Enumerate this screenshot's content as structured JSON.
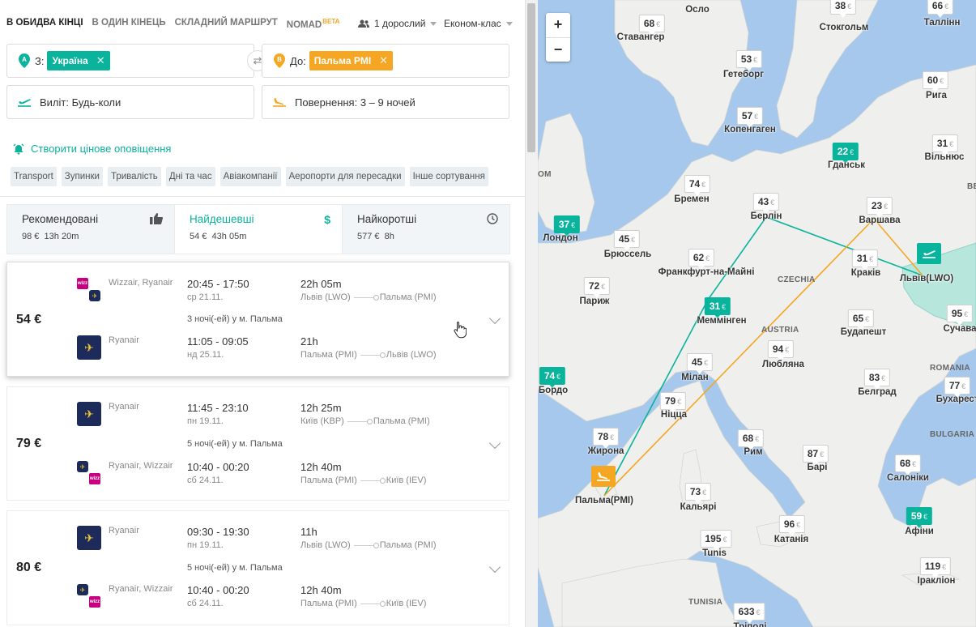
{
  "tabs": [
    {
      "label": "В обидва кінці"
    },
    {
      "label": "В один кінець"
    },
    {
      "label": "Складний маршрут"
    },
    {
      "label": "Nomad",
      "badge": "BETA"
    }
  ],
  "passengers": "1 дорослий",
  "cabin": "Економ-клас",
  "from": {
    "prefix": "З:",
    "chip": "Україна",
    "pin": "A",
    "color": "#0ab39c"
  },
  "to": {
    "prefix": "До:",
    "chip": "Пальма PMI",
    "pin": "B",
    "color": "#f5a623"
  },
  "depart": {
    "label": "Виліт:",
    "value": "Будь-коли"
  },
  "return": {
    "label": "Повернення:",
    "value": "3 – 9 ночей"
  },
  "alert": "Створити цінове оповіщення",
  "filters": [
    "Transport",
    "Зупинки",
    "Тривалість",
    "Дні та час",
    "Авіакомпанії",
    "Аеропорти для пересадки",
    "Інше сортування"
  ],
  "sort": [
    {
      "label": "Рекомендовані",
      "price": "98 €",
      "time": "13h 20m"
    },
    {
      "label": "Найдешевші",
      "price": "54 €",
      "time": "43h 05m"
    },
    {
      "label": "Найкоротші",
      "price": "577 €",
      "time": "8h"
    }
  ],
  "results": [
    {
      "price": "54 €",
      "stay": "3 ночі(-ей) у м. Пальма",
      "out": {
        "airline": "Wizzair, Ryanair",
        "times": "20:45 - 17:50",
        "date": "ср 21.11.",
        "dur": "22h 05m",
        "from": "Львів (LWO)",
        "to": "Пальма (PMI)"
      },
      "back": {
        "airline": "Ryanair",
        "times": "11:05 - 09:05",
        "date": "нд 25.11.",
        "dur": "21h",
        "from": "Пальма (PMI)",
        "to": "Львів (LWO)"
      }
    },
    {
      "price": "79 €",
      "stay": "5 ночі(-ей) у м. Пальма",
      "out": {
        "airline": "Ryanair",
        "times": "11:45 - 23:10",
        "date": "пн 19.11.",
        "dur": "12h 25m",
        "from": "Київ (KBP)",
        "to": "Пальма (PMI)"
      },
      "back": {
        "airline": "Ryanair, Wizzair",
        "times": "10:40 - 00:20",
        "date": "сб 24.11.",
        "dur": "12h 40m",
        "from": "Пальма (PMI)",
        "to": "Київ (IEV)"
      }
    },
    {
      "price": "80 €",
      "stay": "5 ночі(-ей) у м. Пальма",
      "out": {
        "airline": "Ryanair",
        "times": "09:30 - 19:30",
        "date": "пн 19.11.",
        "dur": "11h",
        "from": "Львів (LWO)",
        "to": "Пальма (PMI)"
      },
      "back": {
        "airline": "Ryanair, Wizzair",
        "times": "10:40 - 00:20",
        "date": "сб 24.11.",
        "dur": "12h 40m",
        "from": "Пальма (PMI)",
        "to": "Київ (IEV)"
      }
    }
  ],
  "map": {
    "zoom_in": "+",
    "zoom_out": "−",
    "currency": "€",
    "markers": [
      {
        "price": "68",
        "city": "Ставангер",
        "green": false
      },
      {
        "price": "",
        "city": "Осло",
        "green": false
      },
      {
        "price": "38",
        "city": "Стокгольм",
        "green": false
      },
      {
        "price": "66",
        "city": "Таллінн",
        "green": false
      },
      {
        "price": "53",
        "city": "Гетеборг",
        "green": false
      },
      {
        "price": "60",
        "city": "Рига",
        "green": false
      },
      {
        "price": "57",
        "city": "Копенгаген",
        "green": false
      },
      {
        "price": "31",
        "city": "Вільнюс",
        "green": false
      },
      {
        "price": "22",
        "city": "Гданськ",
        "green": true
      },
      {
        "price": "74",
        "city": "Бремен",
        "green": false
      },
      {
        "price": "43",
        "city": "Берлін",
        "green": false
      },
      {
        "price": "23",
        "city": "Варшава",
        "green": false
      },
      {
        "price": "37",
        "city": "Лондон",
        "green": true
      },
      {
        "price": "45",
        "city": "Брюссель",
        "green": false
      },
      {
        "price": "62",
        "city": "Франкфурт-на-Майні",
        "green": false
      },
      {
        "price": "31",
        "city": "Краків",
        "green": false
      },
      {
        "price": "",
        "city": "Львів(LWO)",
        "green": false
      },
      {
        "price": "72",
        "city": "Париж",
        "green": false
      },
      {
        "price": "31",
        "city": "Меммінген",
        "green": true
      },
      {
        "price": "95",
        "city": "Сучава",
        "green": false
      },
      {
        "price": "65",
        "city": "Будапешт",
        "green": false
      },
      {
        "price": "94",
        "city": "Любляна",
        "green": false
      },
      {
        "price": "45",
        "city": "Мілан",
        "green": false
      },
      {
        "price": "74",
        "city": "Бордо",
        "green": true
      },
      {
        "price": "83",
        "city": "Белград",
        "green": false
      },
      {
        "price": "77",
        "city": "Бухарест",
        "green": false
      },
      {
        "price": "79",
        "city": "Ніцца",
        "green": false
      },
      {
        "price": "78",
        "city": "Жирона",
        "green": false
      },
      {
        "price": "68",
        "city": "Рим",
        "green": false
      },
      {
        "price": "87",
        "city": "Барі",
        "green": false
      },
      {
        "price": "68",
        "city": "Салоніки",
        "green": false
      },
      {
        "price": "",
        "city": "Пальма(PMI)",
        "green": false
      },
      {
        "price": "73",
        "city": "Кальярі",
        "green": false
      },
      {
        "price": "96",
        "city": "Катанія",
        "green": false
      },
      {
        "price": "59",
        "city": "Афіни",
        "green": true
      },
      {
        "price": "195",
        "city": "Tunis",
        "green": false
      },
      {
        "price": "119",
        "city": "Іракліон",
        "green": false
      },
      {
        "price": "633",
        "city": "Тріполі",
        "green": false
      }
    ],
    "countries": [
      "CZECHIA",
      "AUSTRIA",
      "ROMANIA",
      "BULGARIA",
      "TUNISIA",
      "ВЕ",
      "ОМ"
    ]
  }
}
